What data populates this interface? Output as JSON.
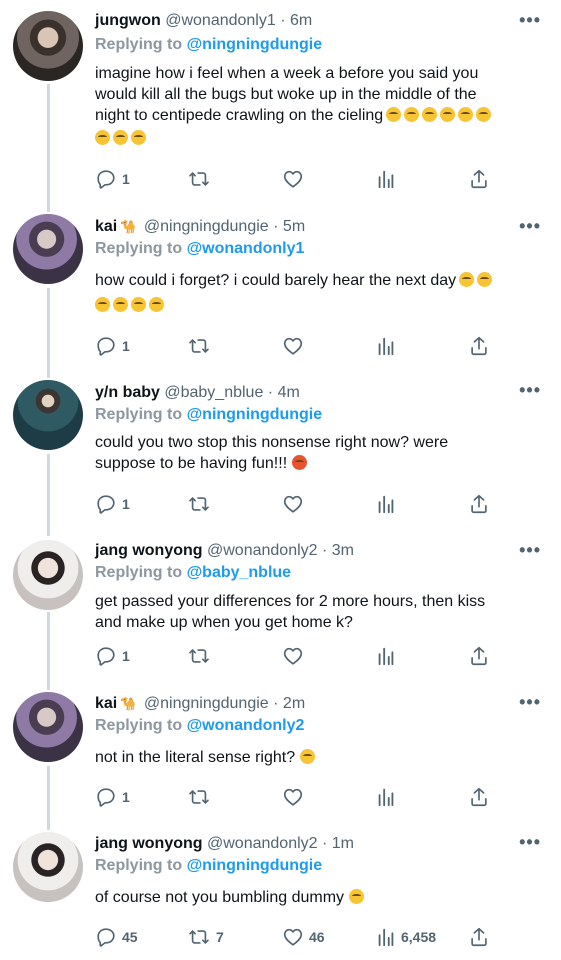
{
  "tweets": [
    {
      "name": "jungwon",
      "badge": "",
      "handle": "@wonandonly1",
      "time": "6m",
      "reply_prefix": "Replying to",
      "reply_to": "@ningningdungie",
      "lines": [
        "imagine how i feel when a week a before you said you",
        "would kill all the bugs but woke up in the middle of the",
        "night to centipede crawling on the cieling"
      ],
      "emoji_line3": 6,
      "emoji_line4": 3,
      "replies": "1",
      "retweets": "",
      "likes": "",
      "views": ""
    },
    {
      "name": "kai",
      "badge": "🐪",
      "handle": "@ningningdungie",
      "time": "5m",
      "reply_prefix": "Replying to",
      "reply_to": "@wonandonly1",
      "lines": [
        "how could i forget? i could barely hear the next day"
      ],
      "replies": "1",
      "retweets": "",
      "likes": "",
      "views": ""
    },
    {
      "name": "y/n baby",
      "badge": "",
      "handle": "@baby_nblue",
      "time": "4m",
      "reply_prefix": "Replying to",
      "reply_to": "@ningningdungie",
      "lines": [
        "could you two stop this nonsense right now? were",
        "suppose to be having fun!!!"
      ],
      "replies": "1",
      "retweets": "",
      "likes": "",
      "views": ""
    },
    {
      "name": "jang wonyong",
      "badge": "",
      "handle": "@wonandonly2",
      "time": "3m",
      "reply_prefix": "Replying to",
      "reply_to": "@baby_nblue",
      "lines": [
        "get passed your differences for 2 more hours, then kiss",
        "and make up when you get home k?"
      ],
      "replies": "1",
      "retweets": "",
      "likes": "",
      "views": ""
    },
    {
      "name": "kai",
      "badge": "🐪",
      "handle": "@ningningdungie",
      "time": "2m",
      "reply_prefix": "Replying to",
      "reply_to": "@wonandonly2",
      "lines": [
        "not in the literal sense right?"
      ],
      "replies": "1",
      "retweets": "",
      "likes": "",
      "views": ""
    },
    {
      "name": "jang wonyong",
      "badge": "",
      "handle": "@wonandonly2",
      "time": "1m",
      "reply_prefix": "Replying to",
      "reply_to": "@ningningdungie",
      "lines": [
        "of course not you bumbling dummy"
      ],
      "replies": "45",
      "retweets": "7",
      "likes": "46",
      "views": "6,458"
    }
  ],
  "separator": "·",
  "icons": {
    "more": "more-dots-icon",
    "reply": "reply-bubble-icon",
    "retweet": "retweet-icon",
    "like": "heart-icon",
    "views": "views-bars-icon",
    "share": "share-icon"
  },
  "colors": {
    "link": "#1d9bf0",
    "muted": "#536471",
    "text": "#0f1419",
    "thread_line": "#cfd9de"
  }
}
